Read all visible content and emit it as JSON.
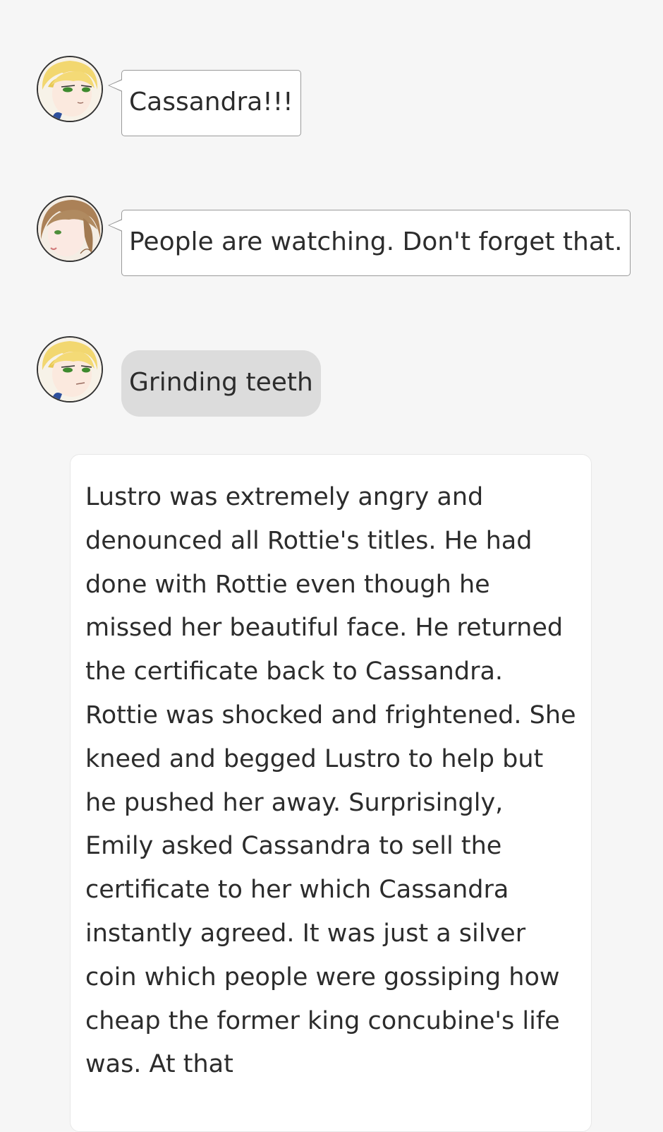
{
  "messages": [
    {
      "speaker_icon": "blonde-character-avatar",
      "kind": "speech",
      "text": "Cassandra!!!"
    },
    {
      "speaker_icon": "brown-hair-character-avatar",
      "kind": "speech",
      "text": "People are watching. Don't forget that."
    },
    {
      "speaker_icon": "blonde-character-avatar",
      "kind": "thought",
      "text": "Grinding teeth"
    }
  ],
  "narration": {
    "text": "Lustro was extremely angry and denounced all Rottie's titles. He had done with Rottie even though he missed her beautiful face. He returned the certificate back to Cassandra. Rottie was shocked and frightened. She kneed and begged Lustro to help but he pushed her away. Surprisingly, Emily asked Cassandra to sell the certificate to her which Cassandra instantly agreed. It was just a silver coin which people were gossiping how cheap the former king concubine's life was. At that"
  },
  "colors": {
    "background": "#f6f6f6",
    "thought_bubble": "#dcdcdc",
    "bubble_border": "#9a9a9a",
    "text": "#2c2c2c"
  }
}
